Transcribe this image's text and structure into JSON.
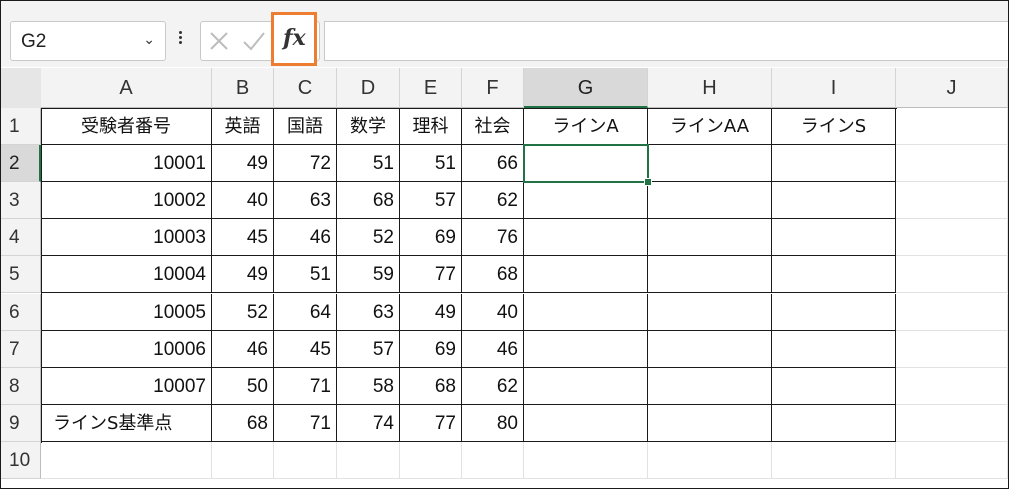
{
  "namebox": {
    "value": "G2"
  },
  "formula_bar": {
    "fx_label": "fx",
    "value": ""
  },
  "columns": [
    "A",
    "B",
    "C",
    "D",
    "E",
    "F",
    "G",
    "H",
    "I",
    "J"
  ],
  "rows": [
    "1",
    "2",
    "3",
    "4",
    "5",
    "6",
    "7",
    "8",
    "9",
    "10"
  ],
  "selected_cell": "G2",
  "headers": [
    "受験者番号",
    "英語",
    "国語",
    "数学",
    "理科",
    "社会",
    "ラインA",
    "ラインAA",
    "ラインS"
  ],
  "data": [
    [
      "10001",
      "49",
      "72",
      "51",
      "51",
      "66"
    ],
    [
      "10002",
      "40",
      "63",
      "68",
      "57",
      "62"
    ],
    [
      "10003",
      "45",
      "46",
      "52",
      "69",
      "76"
    ],
    [
      "10004",
      "49",
      "51",
      "59",
      "77",
      "68"
    ],
    [
      "10005",
      "52",
      "64",
      "63",
      "49",
      "40"
    ],
    [
      "10006",
      "46",
      "45",
      "57",
      "69",
      "46"
    ],
    [
      "10007",
      "50",
      "71",
      "58",
      "68",
      "62"
    ],
    [
      "ラインS基準点",
      "68",
      "71",
      "74",
      "77",
      "80"
    ]
  ]
}
